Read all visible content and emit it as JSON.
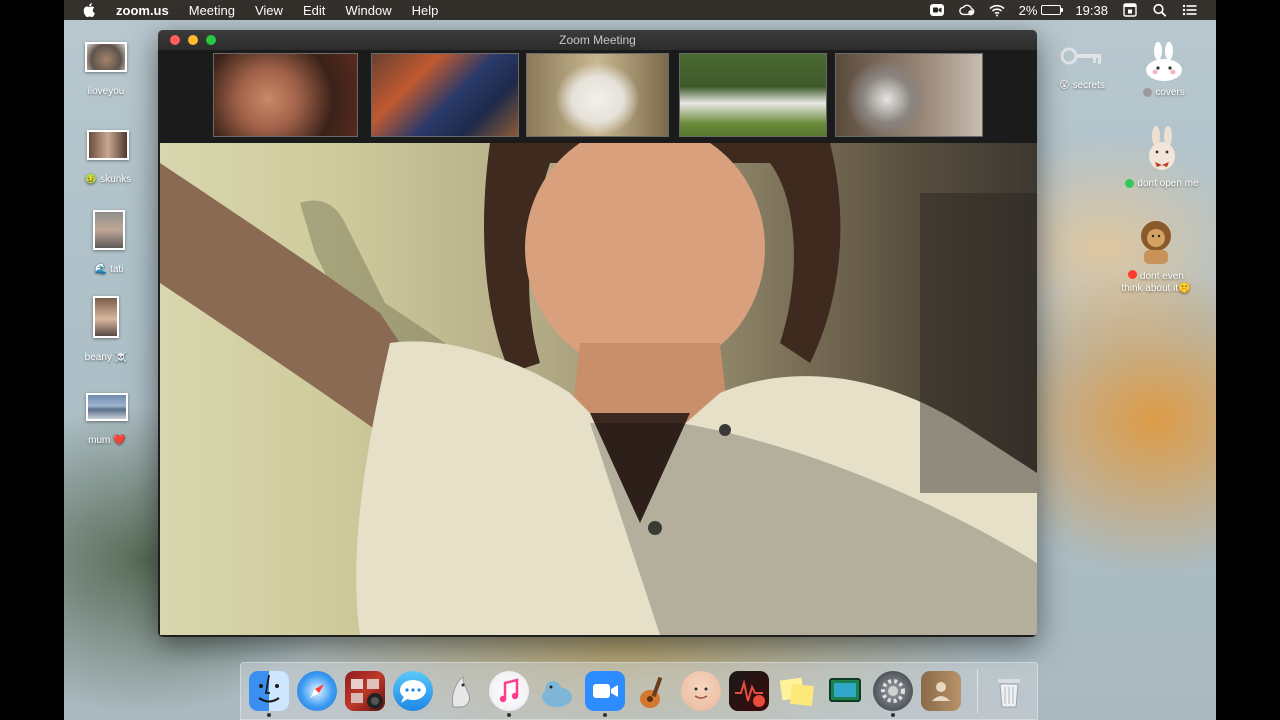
{
  "menubar": {
    "app_name": "zoom.us",
    "menus": [
      "Meeting",
      "View",
      "Edit",
      "Window",
      "Help"
    ],
    "battery_percent": "2%",
    "clock": "19:38",
    "status_icons": [
      "zoom-status-icon",
      "creative-cloud-icon",
      "wifi-icon",
      "battery-icon",
      "calendar-icon",
      "spotlight-search-icon",
      "notification-center-icon"
    ]
  },
  "desktop": {
    "left_items": [
      {
        "label": "iloveyou",
        "tag": ""
      },
      {
        "label": "skunks",
        "tag": "🤢"
      },
      {
        "label": "tati",
        "tag": "🌊"
      },
      {
        "label": "beany",
        "tag": "☠️"
      },
      {
        "label": "mum",
        "tag": "❤️"
      }
    ],
    "right_items": [
      {
        "label": "secrets",
        "tag": "😮"
      },
      {
        "label": "covers",
        "tag": ""
      },
      {
        "label": "dont open me",
        "tag": ""
      },
      {
        "label_line1": "dont even",
        "label_line2": "think about it",
        "tag": "🤫"
      }
    ],
    "tag_colors": {
      "covers": "#9a9a9a",
      "dont_open_me": "#34c759",
      "dont_even": "#ff3b30"
    }
  },
  "zoom_window": {
    "title": "Zoom Meeting",
    "participants": [
      "participant-1",
      "participant-2",
      "participant-3",
      "participant-4",
      "participant-5"
    ]
  },
  "dock": {
    "apps": [
      "finder",
      "safari",
      "photo-booth",
      "messages",
      "mail",
      "music",
      "preview",
      "zoom",
      "garageband",
      "memoji",
      "photo-booth-2",
      "stickies",
      "screen-sharing",
      "system-preferences",
      "contacts"
    ],
    "trash": "trash"
  },
  "colors": {
    "menubar_bg": "#28241e",
    "traffic_close": "#fe5f57",
    "traffic_min": "#febc2e",
    "traffic_max": "#28c840",
    "zoom_blue": "#2d8cff"
  }
}
